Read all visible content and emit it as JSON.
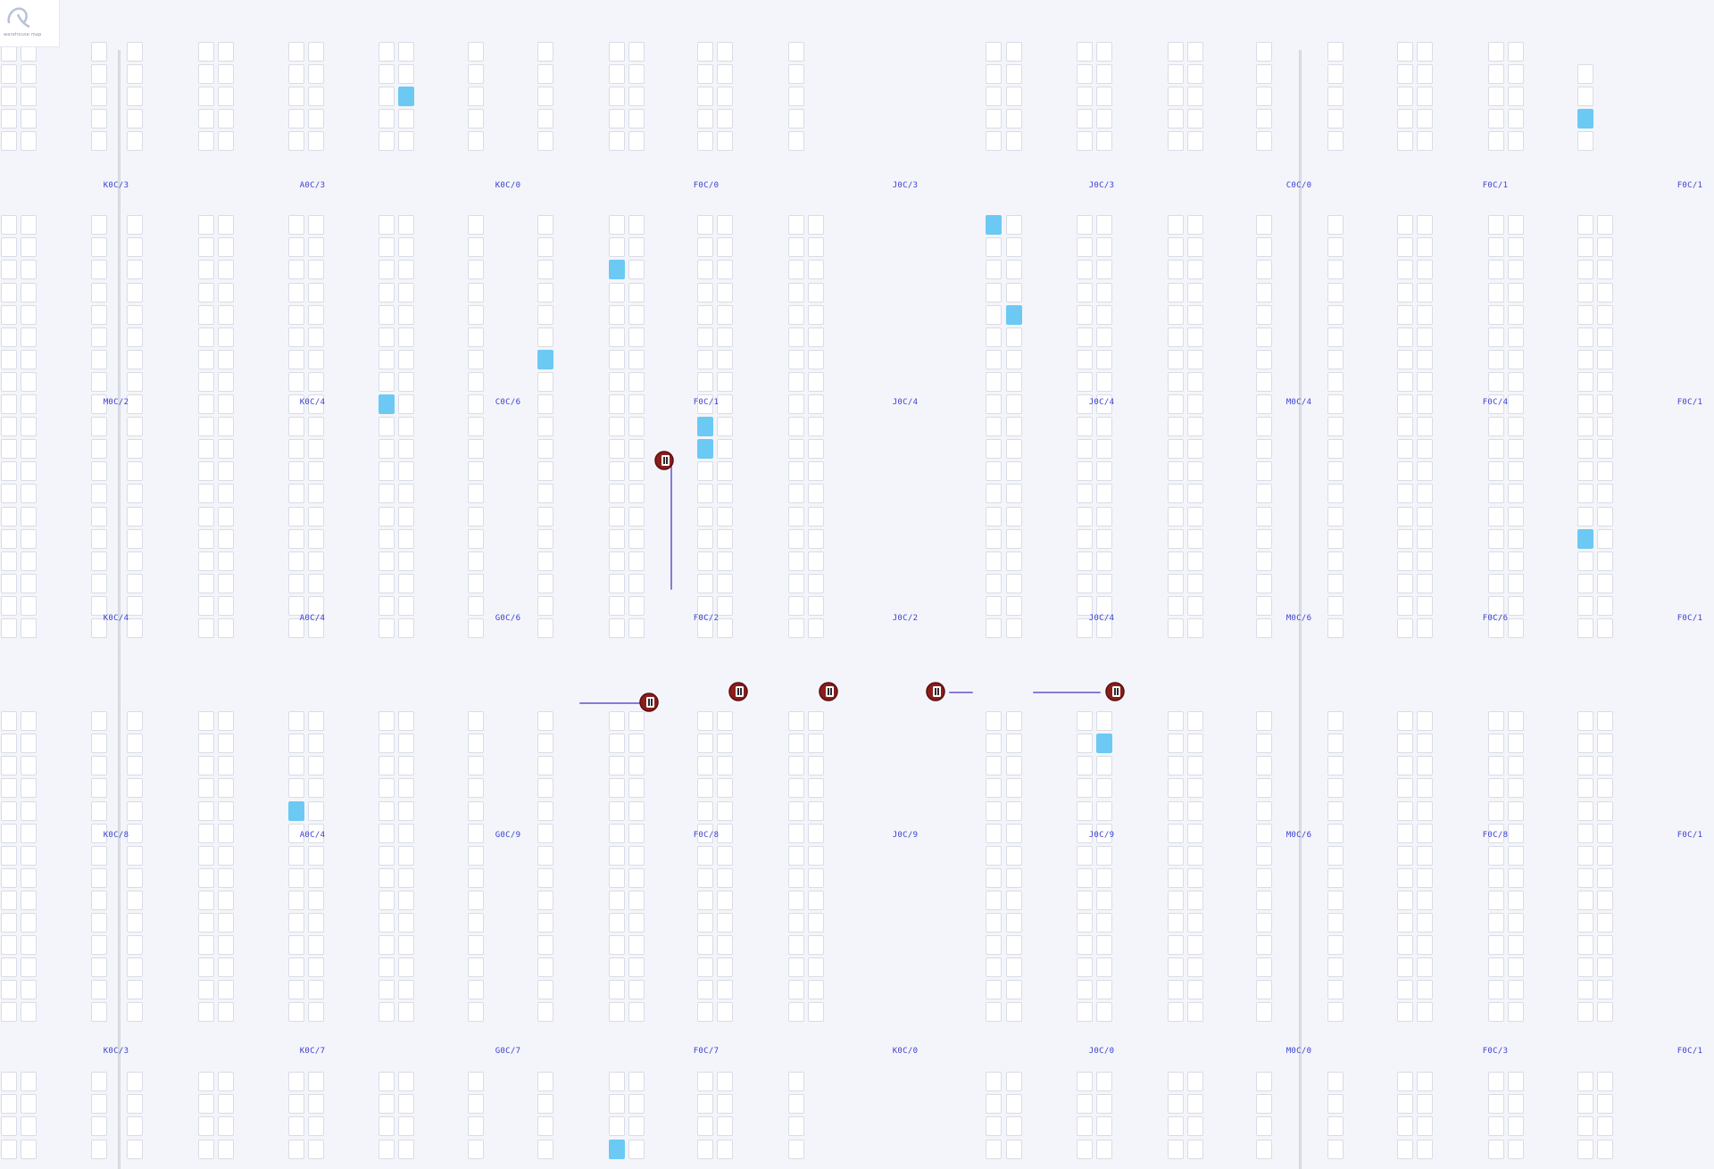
{
  "logo": {
    "caption": "warehouse map"
  },
  "colors": {
    "background": "#f4f5fa",
    "slot_border": "#d9dce6",
    "slot_occupied": "#6cc9f4",
    "aisle_label": "#3a3fd1",
    "robot_body": "#8b1d1d",
    "path": "#8c78d6"
  },
  "aisle_labels": {
    "row1": [
      "K0C/3",
      "A0C/3",
      "K0C/0",
      "F0C/0",
      "J0C/3",
      "J0C/3",
      "C0C/0",
      "F0C/1",
      "F0C/1"
    ],
    "row2": [
      "M0C/2",
      "K0C/4",
      "C0C/6",
      "F0C/1",
      "J0C/4",
      "J0C/4",
      "M0C/4",
      "F0C/4",
      "F0C/1"
    ],
    "row3": [
      "K0C/4",
      "A0C/4",
      "G0C/6",
      "F0C/2",
      "J0C/2",
      "J0C/4",
      "M0C/6",
      "F0C/6",
      "F0C/1"
    ],
    "row4": [
      "K0C/8",
      "A0C/4",
      "G0C/9",
      "F0C/8",
      "J0C/9",
      "J0C/9",
      "M0C/6",
      "F0C/8",
      "F0C/1"
    ],
    "row5": [
      "K0C/3",
      "K0C/7",
      "G0C/7",
      "F0C/7",
      "K0C/0",
      "J0C/0",
      "M0C/0",
      "F0C/3",
      "F0C/1"
    ]
  },
  "robots": [
    {
      "name": "robot-1",
      "icon": "robot-icon"
    },
    {
      "name": "robot-2",
      "icon": "robot-icon"
    },
    {
      "name": "robot-3",
      "icon": "robot-icon"
    },
    {
      "name": "robot-4",
      "icon": "robot-icon"
    },
    {
      "name": "robot-5",
      "icon": "robot-icon"
    },
    {
      "name": "robot-6",
      "icon": "robot-icon"
    }
  ]
}
